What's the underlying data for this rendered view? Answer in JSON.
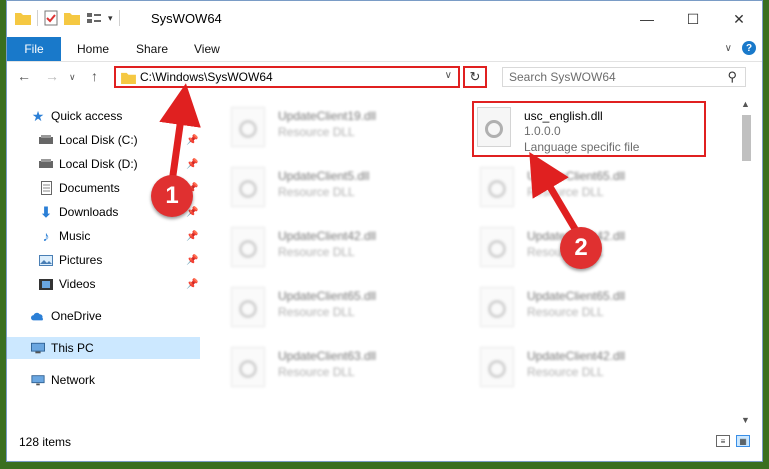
{
  "window": {
    "title": "SysWOW64"
  },
  "ribbon": {
    "tabs": [
      "File",
      "Home",
      "Share",
      "View"
    ]
  },
  "navbar": {
    "address": "C:\\Windows\\SysWOW64",
    "search_placeholder": "Search SysWOW64"
  },
  "sidebar": {
    "items": [
      {
        "label": "Quick access",
        "icon": "star-icon",
        "pinned": false
      },
      {
        "label": "Local Disk (C:)",
        "icon": "drive-icon",
        "pinned": true
      },
      {
        "label": "Local Disk (D:)",
        "icon": "drive-icon",
        "pinned": true
      },
      {
        "label": "Documents",
        "icon": "document-icon",
        "pinned": true
      },
      {
        "label": "Downloads",
        "icon": "download-icon",
        "pinned": true
      },
      {
        "label": "Music",
        "icon": "music-icon",
        "pinned": true
      },
      {
        "label": "Pictures",
        "icon": "picture-icon",
        "pinned": true
      },
      {
        "label": "Videos",
        "icon": "video-icon",
        "pinned": true
      },
      {
        "label": "OneDrive",
        "icon": "cloud-icon",
        "pinned": false
      },
      {
        "label": "This PC",
        "icon": "computer-icon",
        "pinned": false
      },
      {
        "label": "Network",
        "icon": "network-icon",
        "pinned": false
      }
    ]
  },
  "files": {
    "left_column": [
      {
        "name": "UpdateClient19.dll",
        "type": "Resource DLL"
      },
      {
        "name": "UpdateClient5.dll",
        "type": "Resource DLL"
      },
      {
        "name": "UpdateClient42.dll",
        "type": "Resource DLL"
      },
      {
        "name": "UpdateClient65.dll",
        "type": "Resource DLL"
      },
      {
        "name": "UpdateClient63.dll",
        "type": "Resource DLL"
      }
    ],
    "right_column": [
      {
        "name": "UpdateClient65.dll",
        "type": "Resource DLL"
      },
      {
        "name": "UpdateClient42.dll",
        "type": "Resource DLL"
      },
      {
        "name": "UpdateClient65.dll",
        "type": "Resource DLL"
      },
      {
        "name": "UpdateClient42.dll",
        "type": "Resource DLL"
      }
    ],
    "highlighted": {
      "name": "usc_english.dll",
      "version": "1.0.0.0",
      "type": "Language specific file"
    }
  },
  "status": {
    "item_count": "128 items"
  },
  "annotations": {
    "marker1": "1",
    "marker2": "2",
    "color": "#e02020"
  }
}
